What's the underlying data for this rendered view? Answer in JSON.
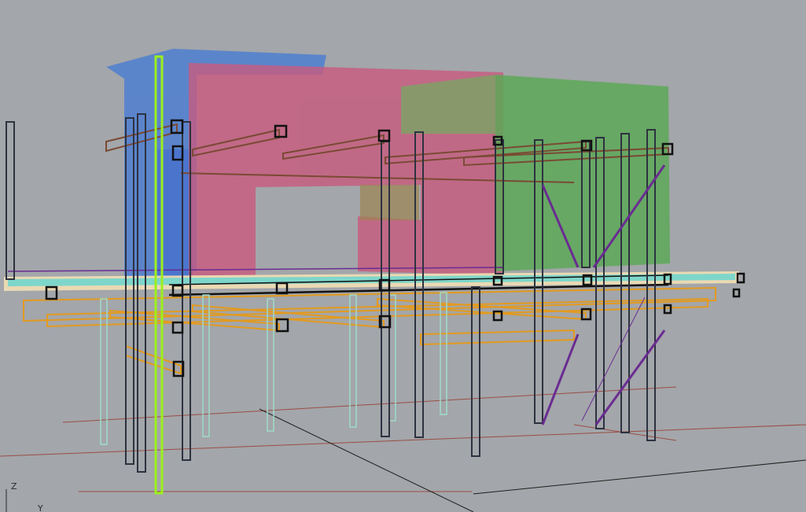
{
  "viewport": {
    "background": "#a3a6aa",
    "axis_labels": {
      "z": "Z",
      "y": "Y"
    }
  },
  "colors": {
    "cloud_blue": "#4f7fd1",
    "cloud_red": "#c85a7e",
    "cloud_green": "#5da858",
    "column_dark": "#2d3240",
    "beam_orange": "#e39a1e",
    "beam_brown": "#7a4a34",
    "brace_purple": "#6a2c91",
    "slab_cyan": "#63d4cf",
    "slab_cream": "#f2dfb4",
    "highlight_green": "#9cf01c",
    "ghost_mint": "#9fdcc8",
    "ground_line_red": "#9a4d46",
    "ground_line_black": "#1f1f1f"
  }
}
